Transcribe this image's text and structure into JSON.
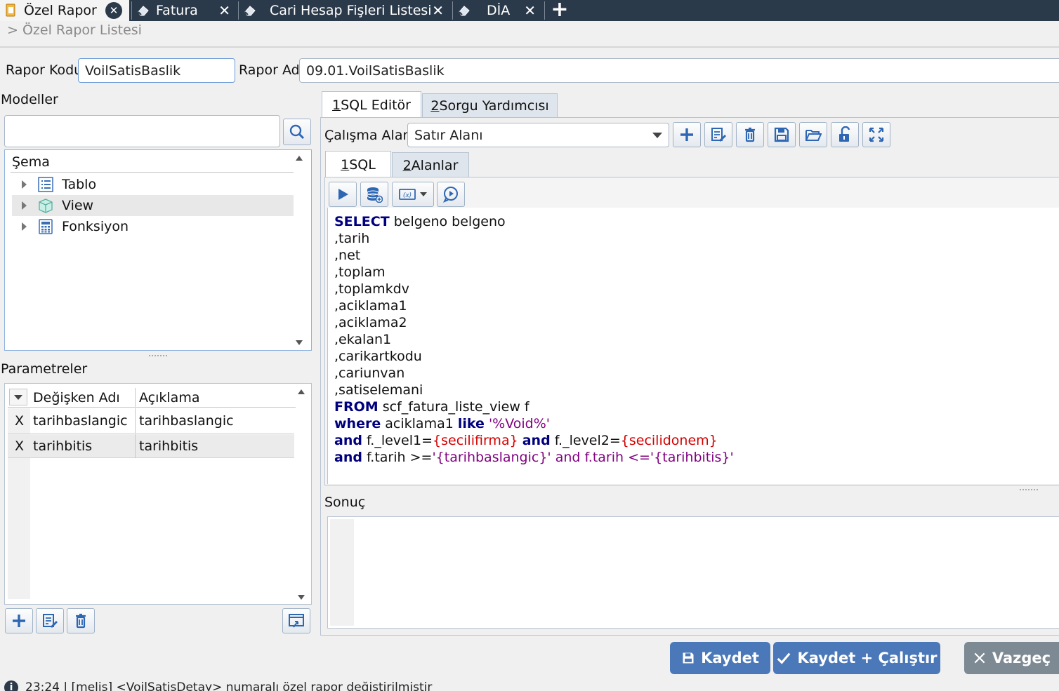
{
  "tabs": [
    {
      "label": "Özel Rapor",
      "active": true
    },
    {
      "label": "Fatura",
      "active": false
    },
    {
      "label": "Cari Hesap Fişleri Listesi",
      "active": false
    },
    {
      "label": "DİA",
      "active": false
    }
  ],
  "tab_close": "✕",
  "tab_add": "+",
  "breadcrumb": "> Özel Rapor Listesi",
  "header": {
    "rapor_kodu_label": "Rapor Kodu",
    "rapor_kodu_value": "VoilSatisBaslik",
    "rapor_adi_label": "Rapor Adı",
    "rapor_adi_value": "09.01.VoilSatisBaslik"
  },
  "modeller": {
    "title": "Modeller",
    "search_value": "",
    "tree_header": "Şema",
    "items": [
      "Tablo",
      "View",
      "Fonksiyon"
    ]
  },
  "parametreler": {
    "title": "Parametreler",
    "columns": [
      "Değişken Adı",
      "Açıklama"
    ],
    "rows": [
      {
        "mark": "X",
        "name": "tarihbaslangic",
        "desc": "tarihbaslangic"
      },
      {
        "mark": "X",
        "name": "tarihbitis",
        "desc": "tarihbitis"
      }
    ]
  },
  "editor_tabs": {
    "sql_editor_num": "1",
    "sql_editor_label": " SQL Editör",
    "sorgu_num": "2",
    "sorgu_label": " Sorgu Yardımcısı"
  },
  "calisma": {
    "label": "Çalışma Alanı",
    "value": "Satır Alanı"
  },
  "inner_tabs": {
    "sql_num": "1",
    "sql_label": " SQL",
    "alanlar_num": "2",
    "alanlar_label": " Alanlar"
  },
  "sql_lines": [
    [
      {
        "t": "SELECT",
        "c": "kw"
      },
      {
        "t": " belgeno belgeno",
        "c": ""
      }
    ],
    [
      {
        "t": ",tarih",
        "c": ""
      }
    ],
    [
      {
        "t": ",net",
        "c": ""
      }
    ],
    [
      {
        "t": ",toplam",
        "c": ""
      }
    ],
    [
      {
        "t": ",toplamkdv",
        "c": ""
      }
    ],
    [
      {
        "t": ",aciklama1",
        "c": ""
      }
    ],
    [
      {
        "t": ",aciklama2",
        "c": ""
      }
    ],
    [
      {
        "t": ",ekalan1",
        "c": ""
      }
    ],
    [
      {
        "t": ",carikartkodu",
        "c": ""
      }
    ],
    [
      {
        "t": ",cariunvan",
        "c": ""
      }
    ],
    [
      {
        "t": ",satiselemani",
        "c": ""
      }
    ],
    [
      {
        "t": "FROM",
        "c": "kw"
      },
      {
        "t": " scf_fatura_liste_view f",
        "c": ""
      }
    ],
    [
      {
        "t": "where",
        "c": "kw"
      },
      {
        "t": " aciklama1 ",
        "c": ""
      },
      {
        "t": "like",
        "c": "kw"
      },
      {
        "t": " ",
        "c": ""
      },
      {
        "t": "'%Void%'",
        "c": "str"
      }
    ],
    [
      {
        "t": "and",
        "c": "kw"
      },
      {
        "t": " f._level1=",
        "c": ""
      },
      {
        "t": "{secilifirma}",
        "c": "param"
      },
      {
        "t": " ",
        "c": ""
      },
      {
        "t": "and",
        "c": "kw"
      },
      {
        "t": " f._level2=",
        "c": ""
      },
      {
        "t": "{secilidonem}",
        "c": "param"
      }
    ],
    [
      {
        "t": "and",
        "c": "kw"
      },
      {
        "t": " f.tarih >=",
        "c": ""
      },
      {
        "t": "'{tarihbaslangic}' and f.tarih <='{tarihbitis}'",
        "c": "str"
      }
    ]
  ],
  "sonuc_label": "Sonuç",
  "actions": {
    "kaydet": "Kaydet",
    "kaydet_calistir": "Kaydet + Çalıştır",
    "vazgec": "Vazgeç"
  },
  "status_text": "23:24 | [melis]  <VoilSatisDetay> numaralı özel rapor değiştirilmiştir",
  "colors": {
    "tabbar": "#2b3a4a",
    "primary_button": "#4a78b8",
    "cancel_button": "#7d8a94",
    "keyword": "#00007f",
    "string": "#7f007f",
    "param": "#d40000"
  }
}
